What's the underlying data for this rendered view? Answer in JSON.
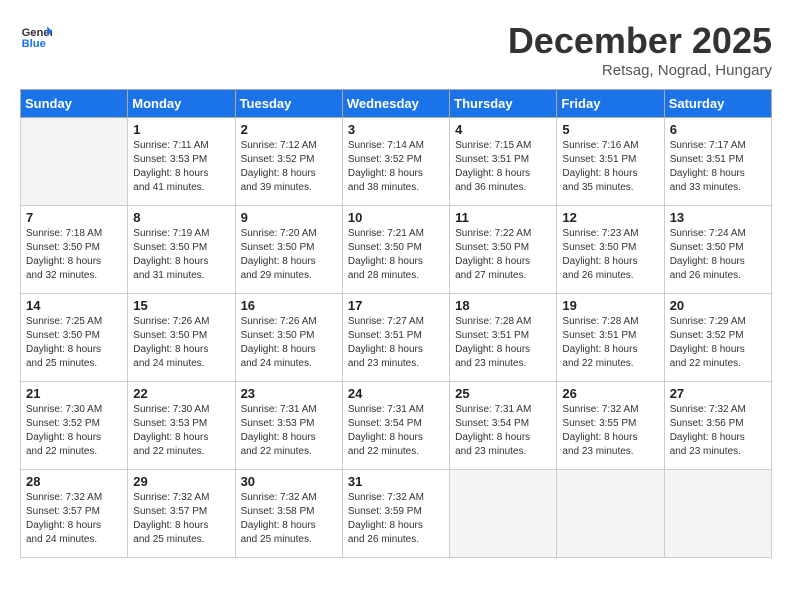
{
  "header": {
    "logo_line1": "General",
    "logo_line2": "Blue",
    "month": "December 2025",
    "location": "Retsag, Nograd, Hungary"
  },
  "days_of_week": [
    "Sunday",
    "Monday",
    "Tuesday",
    "Wednesday",
    "Thursday",
    "Friday",
    "Saturday"
  ],
  "weeks": [
    [
      {
        "day": "",
        "info": ""
      },
      {
        "day": "1",
        "info": "Sunrise: 7:11 AM\nSunset: 3:53 PM\nDaylight: 8 hours\nand 41 minutes."
      },
      {
        "day": "2",
        "info": "Sunrise: 7:12 AM\nSunset: 3:52 PM\nDaylight: 8 hours\nand 39 minutes."
      },
      {
        "day": "3",
        "info": "Sunrise: 7:14 AM\nSunset: 3:52 PM\nDaylight: 8 hours\nand 38 minutes."
      },
      {
        "day": "4",
        "info": "Sunrise: 7:15 AM\nSunset: 3:51 PM\nDaylight: 8 hours\nand 36 minutes."
      },
      {
        "day": "5",
        "info": "Sunrise: 7:16 AM\nSunset: 3:51 PM\nDaylight: 8 hours\nand 35 minutes."
      },
      {
        "day": "6",
        "info": "Sunrise: 7:17 AM\nSunset: 3:51 PM\nDaylight: 8 hours\nand 33 minutes."
      }
    ],
    [
      {
        "day": "7",
        "info": "Sunrise: 7:18 AM\nSunset: 3:50 PM\nDaylight: 8 hours\nand 32 minutes."
      },
      {
        "day": "8",
        "info": "Sunrise: 7:19 AM\nSunset: 3:50 PM\nDaylight: 8 hours\nand 31 minutes."
      },
      {
        "day": "9",
        "info": "Sunrise: 7:20 AM\nSunset: 3:50 PM\nDaylight: 8 hours\nand 29 minutes."
      },
      {
        "day": "10",
        "info": "Sunrise: 7:21 AM\nSunset: 3:50 PM\nDaylight: 8 hours\nand 28 minutes."
      },
      {
        "day": "11",
        "info": "Sunrise: 7:22 AM\nSunset: 3:50 PM\nDaylight: 8 hours\nand 27 minutes."
      },
      {
        "day": "12",
        "info": "Sunrise: 7:23 AM\nSunset: 3:50 PM\nDaylight: 8 hours\nand 26 minutes."
      },
      {
        "day": "13",
        "info": "Sunrise: 7:24 AM\nSunset: 3:50 PM\nDaylight: 8 hours\nand 26 minutes."
      }
    ],
    [
      {
        "day": "14",
        "info": "Sunrise: 7:25 AM\nSunset: 3:50 PM\nDaylight: 8 hours\nand 25 minutes."
      },
      {
        "day": "15",
        "info": "Sunrise: 7:26 AM\nSunset: 3:50 PM\nDaylight: 8 hours\nand 24 minutes."
      },
      {
        "day": "16",
        "info": "Sunrise: 7:26 AM\nSunset: 3:50 PM\nDaylight: 8 hours\nand 24 minutes."
      },
      {
        "day": "17",
        "info": "Sunrise: 7:27 AM\nSunset: 3:51 PM\nDaylight: 8 hours\nand 23 minutes."
      },
      {
        "day": "18",
        "info": "Sunrise: 7:28 AM\nSunset: 3:51 PM\nDaylight: 8 hours\nand 23 minutes."
      },
      {
        "day": "19",
        "info": "Sunrise: 7:28 AM\nSunset: 3:51 PM\nDaylight: 8 hours\nand 22 minutes."
      },
      {
        "day": "20",
        "info": "Sunrise: 7:29 AM\nSunset: 3:52 PM\nDaylight: 8 hours\nand 22 minutes."
      }
    ],
    [
      {
        "day": "21",
        "info": "Sunrise: 7:30 AM\nSunset: 3:52 PM\nDaylight: 8 hours\nand 22 minutes."
      },
      {
        "day": "22",
        "info": "Sunrise: 7:30 AM\nSunset: 3:53 PM\nDaylight: 8 hours\nand 22 minutes."
      },
      {
        "day": "23",
        "info": "Sunrise: 7:31 AM\nSunset: 3:53 PM\nDaylight: 8 hours\nand 22 minutes."
      },
      {
        "day": "24",
        "info": "Sunrise: 7:31 AM\nSunset: 3:54 PM\nDaylight: 8 hours\nand 22 minutes."
      },
      {
        "day": "25",
        "info": "Sunrise: 7:31 AM\nSunset: 3:54 PM\nDaylight: 8 hours\nand 23 minutes."
      },
      {
        "day": "26",
        "info": "Sunrise: 7:32 AM\nSunset: 3:55 PM\nDaylight: 8 hours\nand 23 minutes."
      },
      {
        "day": "27",
        "info": "Sunrise: 7:32 AM\nSunset: 3:56 PM\nDaylight: 8 hours\nand 23 minutes."
      }
    ],
    [
      {
        "day": "28",
        "info": "Sunrise: 7:32 AM\nSunset: 3:57 PM\nDaylight: 8 hours\nand 24 minutes."
      },
      {
        "day": "29",
        "info": "Sunrise: 7:32 AM\nSunset: 3:57 PM\nDaylight: 8 hours\nand 25 minutes."
      },
      {
        "day": "30",
        "info": "Sunrise: 7:32 AM\nSunset: 3:58 PM\nDaylight: 8 hours\nand 25 minutes."
      },
      {
        "day": "31",
        "info": "Sunrise: 7:32 AM\nSunset: 3:59 PM\nDaylight: 8 hours\nand 26 minutes."
      },
      {
        "day": "",
        "info": ""
      },
      {
        "day": "",
        "info": ""
      },
      {
        "day": "",
        "info": ""
      }
    ]
  ]
}
